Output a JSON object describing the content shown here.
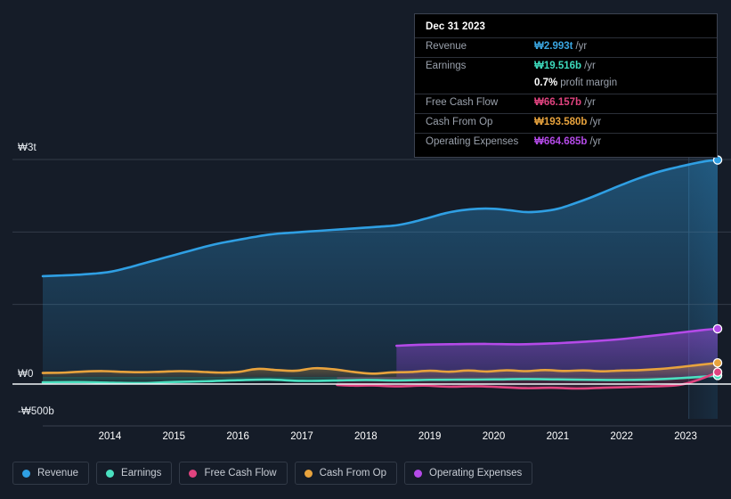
{
  "background": "#151c28",
  "tooltip": {
    "title": "Dec 31 2023",
    "rows": [
      {
        "key": "Revenue",
        "value": "₩2.993t",
        "unit": "/yr",
        "color": "#3aa5e0"
      },
      {
        "key": "Earnings",
        "value": "₩19.516b",
        "unit": "/yr",
        "color": "#3ddbbd"
      },
      {
        "key": "",
        "value": "0.7%",
        "unit": "profit margin",
        "color": "#ffffff",
        "margin": true
      },
      {
        "key": "Free Cash Flow",
        "value": "₩66.157b",
        "unit": "/yr",
        "color": "#e0437f"
      },
      {
        "key": "Cash From Op",
        "value": "₩193.580b",
        "unit": "/yr",
        "color": "#e8a33d"
      },
      {
        "key": "Operating Expenses",
        "value": "₩664.685b",
        "unit": "/yr",
        "color": "#b44ae8"
      }
    ]
  },
  "legend": {
    "items": [
      {
        "label": "Revenue",
        "color": "#2f9fe3"
      },
      {
        "label": "Earnings",
        "color": "#4ae0c0"
      },
      {
        "label": "Free Cash Flow",
        "color": "#e0437f"
      },
      {
        "label": "Cash From Op",
        "color": "#e8a33d"
      },
      {
        "label": "Operating Expenses",
        "color": "#b44ae8"
      }
    ]
  },
  "chart_data": {
    "type": "area",
    "title": "",
    "xlabel": "",
    "ylabel": "",
    "currency": "₩ (KRW)",
    "grid": true,
    "legend_position": "bottom",
    "ylim": [
      -500,
      3000
    ],
    "yunit": "billion KRW",
    "ytick_labels": [
      "₩3t",
      "₩0",
      "-₩500b"
    ],
    "ytick_values": [
      3000,
      0,
      -500
    ],
    "gridline_values": [
      3000,
      2000,
      1000,
      0
    ],
    "xtick_labels": [
      "2014",
      "2015",
      "2016",
      "2017",
      "2018",
      "2019",
      "2020",
      "2021",
      "2022",
      "2023"
    ],
    "x_start": 2013.45,
    "x_end": 2024.0,
    "forecast_start": 2023.55,
    "series": [
      {
        "name": "Revenue",
        "color": "#2f9fe3",
        "x": [
          2013.45,
          2013.75,
          2014.0,
          2014.25,
          2014.5,
          2014.75,
          2015.0,
          2015.25,
          2015.5,
          2015.75,
          2016.0,
          2016.25,
          2016.5,
          2016.75,
          2017.0,
          2017.25,
          2017.5,
          2017.75,
          2018.0,
          2018.25,
          2018.5,
          2018.75,
          2019.0,
          2019.25,
          2019.5,
          2019.75,
          2020.0,
          2020.25,
          2020.5,
          2020.75,
          2021.0,
          2021.25,
          2021.5,
          2021.75,
          2022.0,
          2022.25,
          2022.5,
          2022.75,
          2023.0,
          2023.25,
          2023.55,
          2023.8,
          2024.0
        ],
        "values": [
          1390,
          1400,
          1410,
          1425,
          1450,
          1500,
          1560,
          1620,
          1680,
          1740,
          1800,
          1850,
          1890,
          1930,
          1965,
          1985,
          2000,
          2015,
          2030,
          2045,
          2060,
          2075,
          2095,
          2140,
          2200,
          2260,
          2300,
          2320,
          2320,
          2300,
          2275,
          2285,
          2320,
          2390,
          2470,
          2560,
          2650,
          2735,
          2810,
          2870,
          2930,
          2975,
          2993
        ]
      },
      {
        "name": "Earnings",
        "color": "#4ae0c0",
        "x": [
          2013.45,
          2014.0,
          2014.5,
          2015.0,
          2015.5,
          2016.0,
          2016.5,
          2017.0,
          2017.5,
          2018.0,
          2018.5,
          2019.0,
          2019.5,
          2020.0,
          2020.5,
          2021.0,
          2021.5,
          2022.0,
          2022.5,
          2023.0,
          2023.55,
          2024.0
        ],
        "values": [
          -75,
          -72,
          -80,
          -85,
          -70,
          -60,
          -45,
          -38,
          -55,
          -50,
          -42,
          -48,
          -40,
          -38,
          -35,
          -30,
          -35,
          -40,
          -42,
          -35,
          -10,
          19.5
        ]
      },
      {
        "name": "Free Cash Flow",
        "color": "#e0437f",
        "x": [
          2018.05,
          2018.3,
          2018.6,
          2019.0,
          2019.4,
          2019.8,
          2020.2,
          2020.6,
          2021.0,
          2021.4,
          2021.8,
          2022.2,
          2022.6,
          2023.0,
          2023.4,
          2023.7,
          2024.0
        ],
        "values": [
          -110,
          -120,
          -118,
          -130,
          -120,
          -135,
          -128,
          -140,
          -155,
          -150,
          -160,
          -150,
          -140,
          -130,
          -110,
          -40,
          66.2
        ]
      },
      {
        "name": "Cash From Op",
        "color": "#e8a33d",
        "x": [
          2013.45,
          2013.8,
          2014.1,
          2014.4,
          2014.7,
          2015.0,
          2015.3,
          2015.6,
          2015.9,
          2016.2,
          2016.5,
          2016.8,
          2017.1,
          2017.4,
          2017.7,
          2018.0,
          2018.3,
          2018.6,
          2018.9,
          2019.2,
          2019.5,
          2019.8,
          2020.1,
          2020.4,
          2020.7,
          2021.0,
          2021.3,
          2021.6,
          2021.9,
          2022.2,
          2022.5,
          2022.8,
          2023.1,
          2023.4,
          2023.7,
          2024.0
        ],
        "values": [
          55,
          60,
          75,
          80,
          70,
          65,
          72,
          80,
          72,
          60,
          68,
          110,
          95,
          85,
          120,
          105,
          70,
          45,
          62,
          68,
          85,
          72,
          88,
          75,
          92,
          80,
          95,
          82,
          90,
          78,
          88,
          95,
          110,
          135,
          165,
          193.6
        ]
      },
      {
        "name": "Operating Expenses",
        "color": "#b44ae8",
        "x": [
          2018.98,
          2019.4,
          2019.9,
          2020.4,
          2020.9,
          2021.4,
          2021.9,
          2022.4,
          2022.9,
          2023.4,
          2023.8,
          2024.0
        ],
        "values": [
          430,
          445,
          452,
          455,
          450,
          462,
          485,
          515,
          560,
          610,
          650,
          664.7
        ]
      }
    ]
  }
}
